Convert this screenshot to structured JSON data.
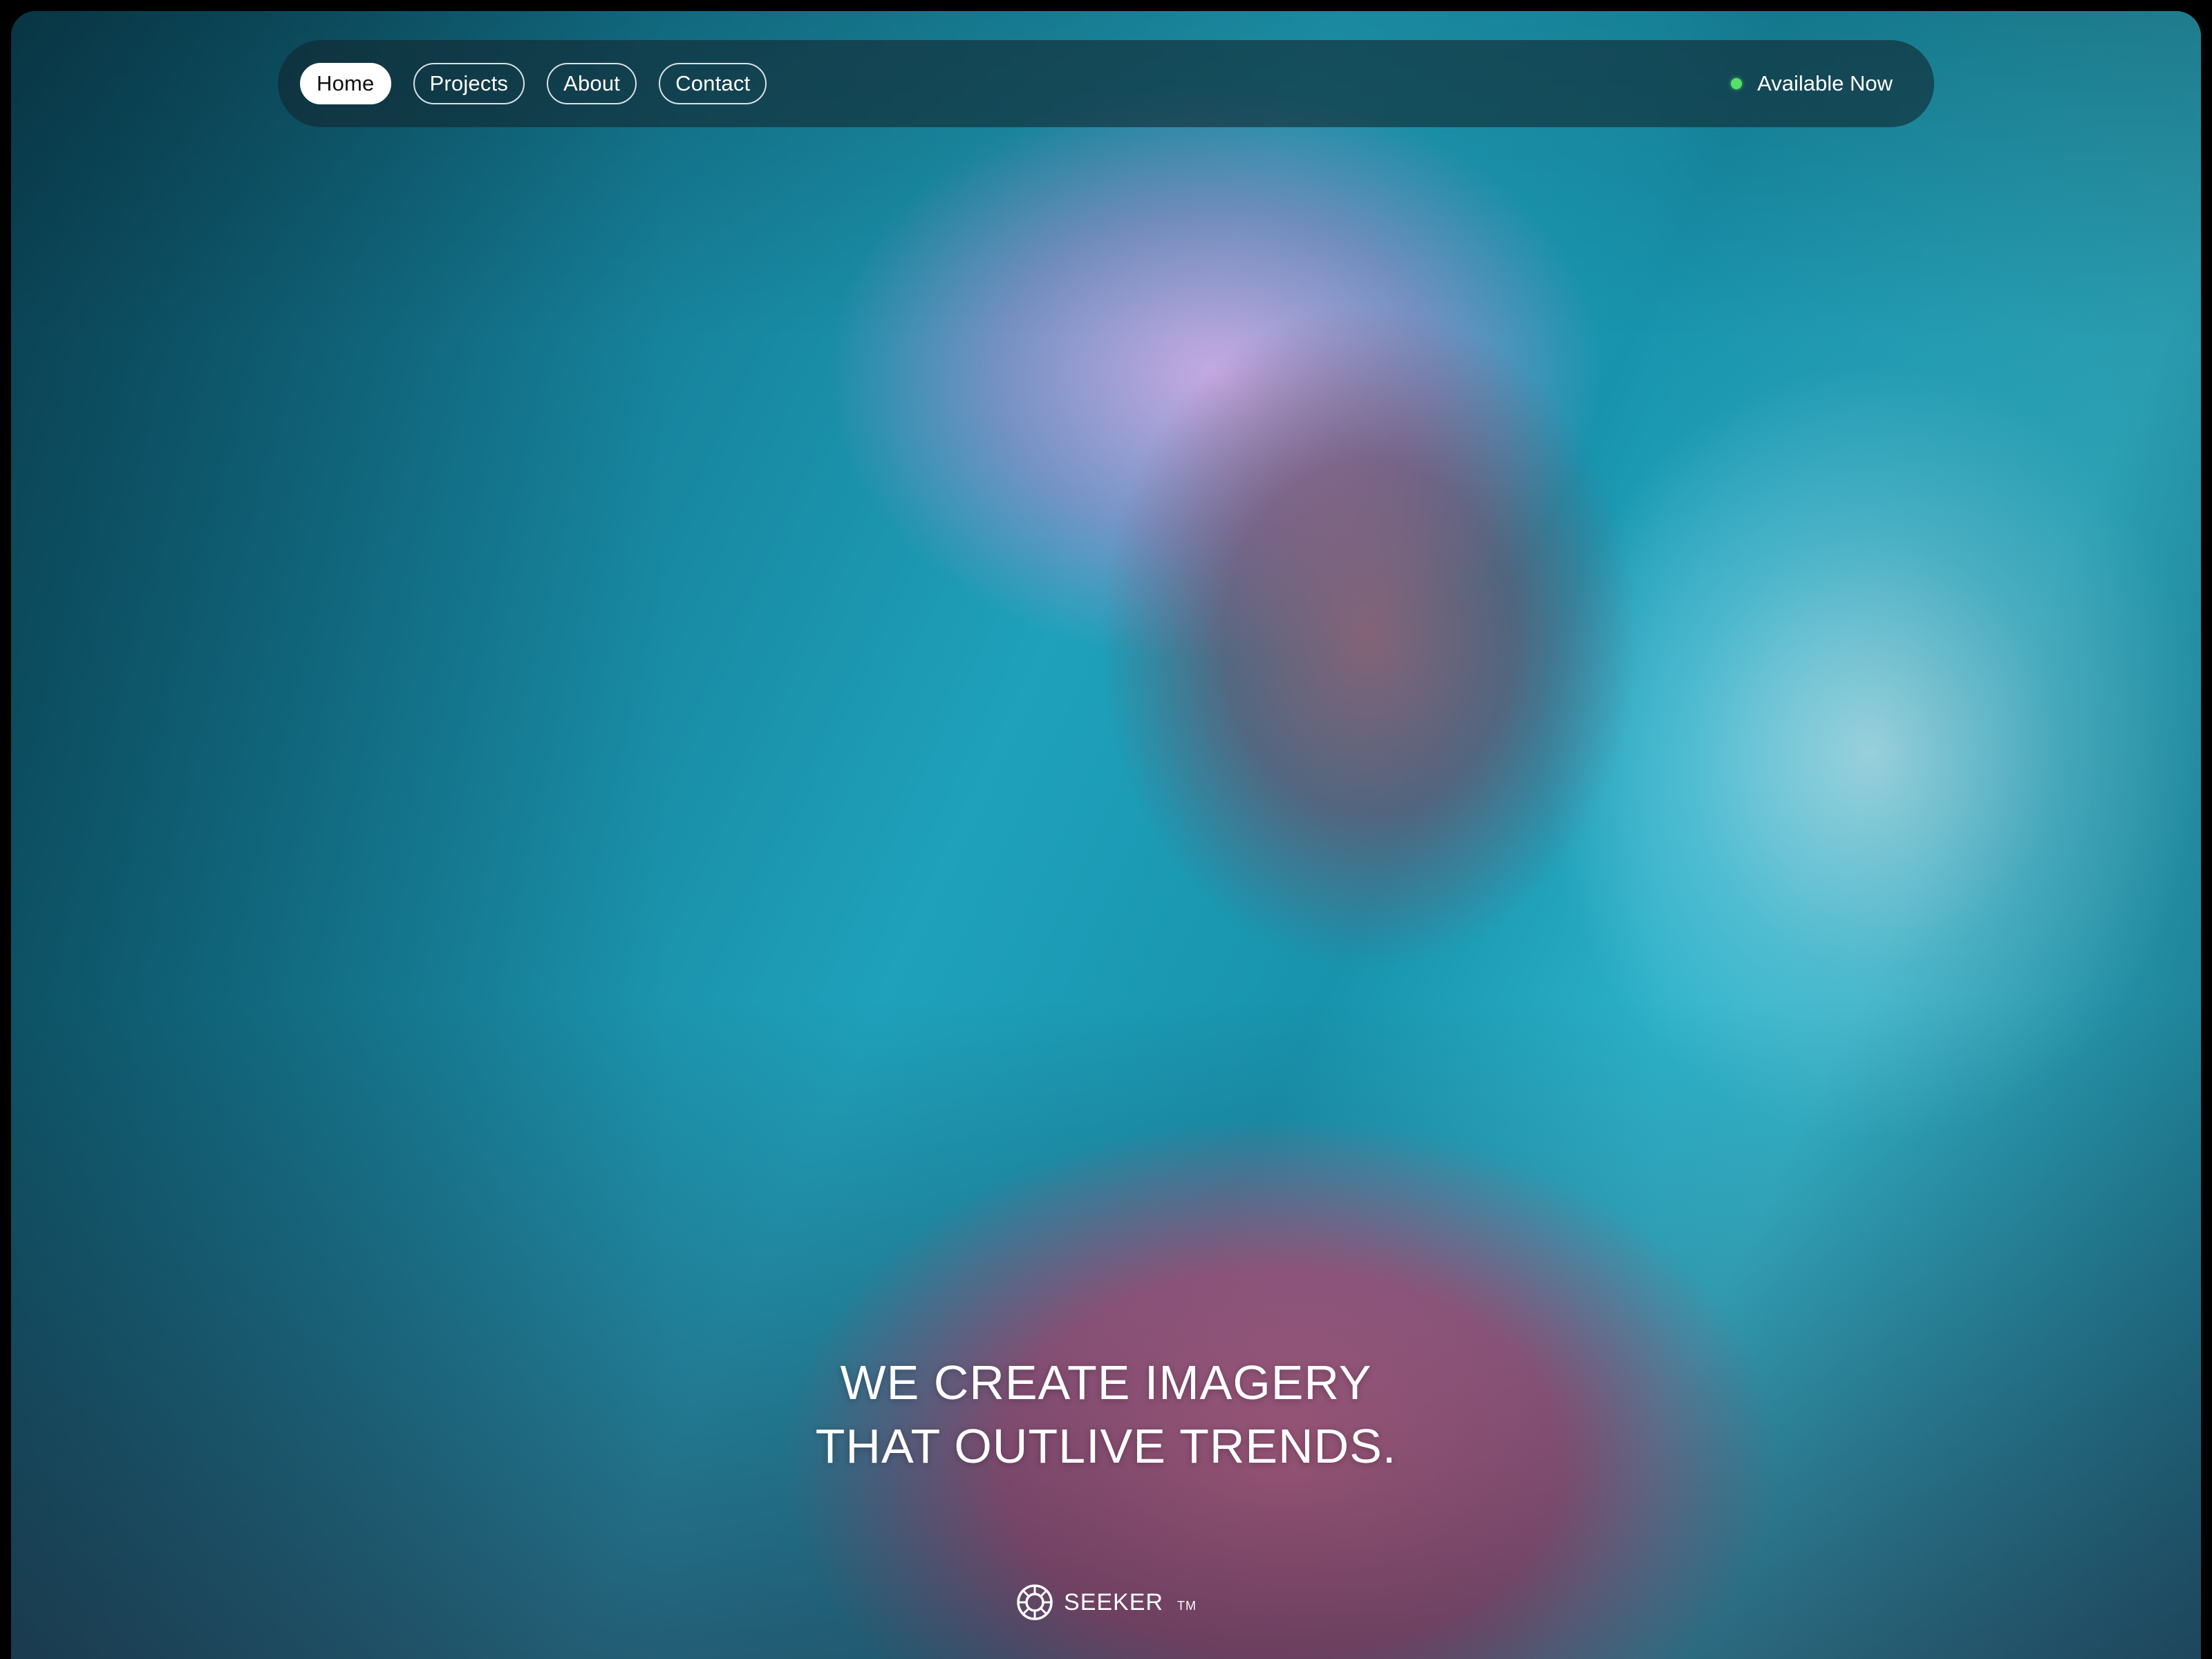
{
  "nav": {
    "items": [
      {
        "label": "Home",
        "active": true
      },
      {
        "label": "Projects",
        "active": false
      },
      {
        "label": "About",
        "active": false
      },
      {
        "label": "Contact",
        "active": false
      }
    ],
    "status": {
      "label": "Available Now",
      "dot_color": "#56e06a"
    }
  },
  "hero": {
    "headline_line1": "WE CREATE IMAGERY",
    "headline_line2": "THAT OUTLIVE TRENDS.",
    "image_icon": "portrait-photo"
  },
  "brand": {
    "name": "SEEKER",
    "trademark": "TM",
    "icon": "seeker-logo-icon"
  },
  "colors": {
    "accent_status": "#56e06a",
    "nav_background": "#12263099",
    "text": "#ffffff",
    "background_teal": "#1a8ea8",
    "shirt_pink": "#cd6e96",
    "hair_lavender": "#d7aae6"
  }
}
